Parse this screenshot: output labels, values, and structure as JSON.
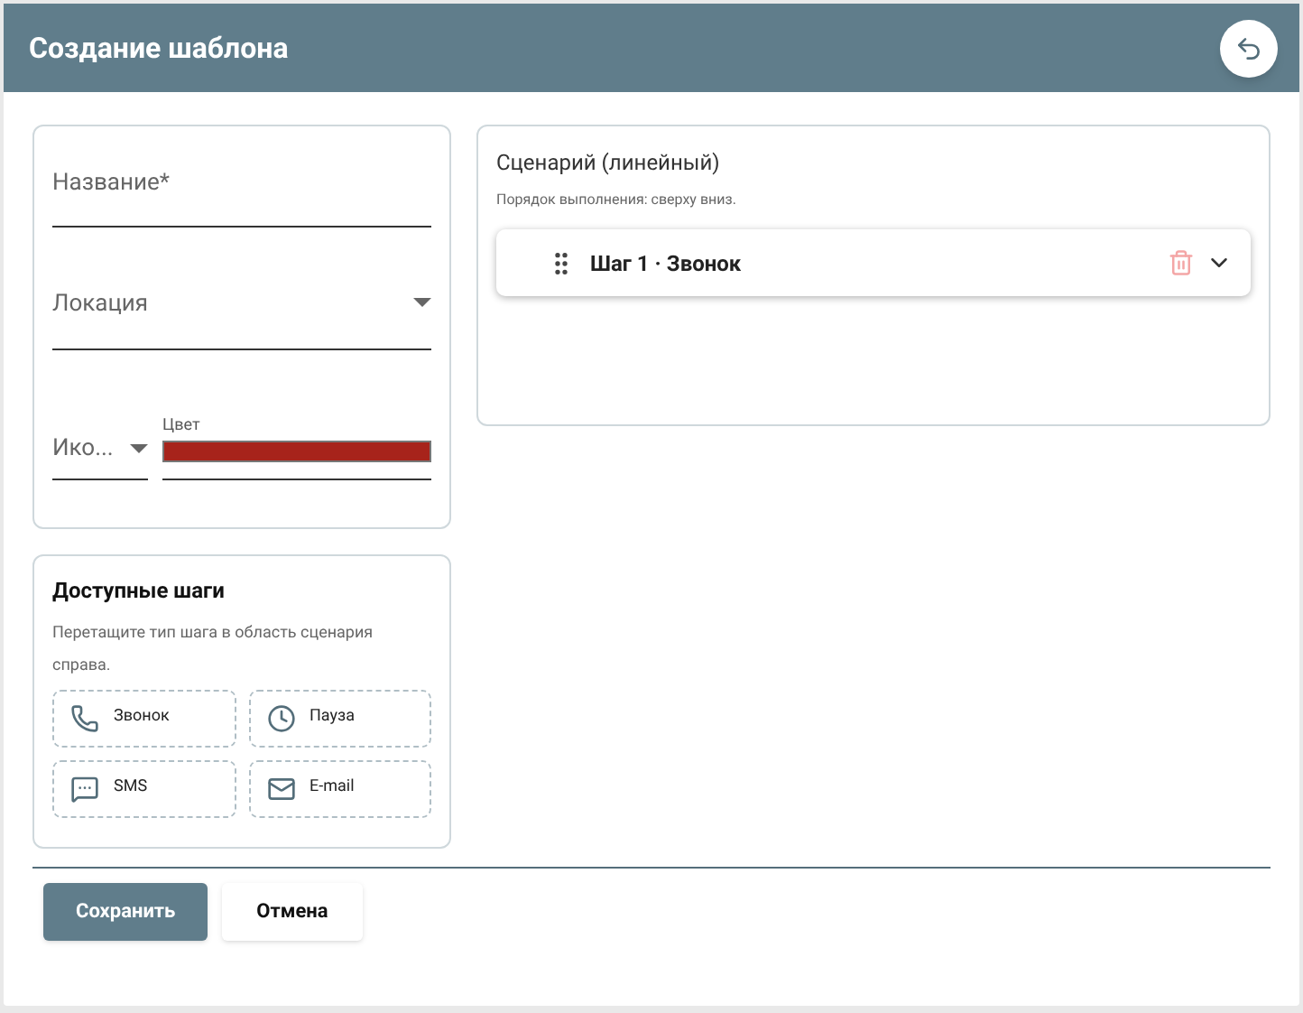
{
  "header": {
    "title": "Создание шаблона"
  },
  "form": {
    "name": {
      "label": "Название*"
    },
    "location": {
      "label": "Локация"
    },
    "icon": {
      "label": "Ико..."
    },
    "color": {
      "label": "Цвет",
      "color": "#a7231b"
    }
  },
  "available_steps": {
    "title": "Доступные шаги",
    "hint": "Перетащите тип шага в область сценария справа.",
    "items": [
      {
        "kind": "call",
        "label": "Звонок"
      },
      {
        "kind": "pause",
        "label": "Пауза"
      },
      {
        "kind": "sms",
        "label": "SMS"
      },
      {
        "kind": "email",
        "label": "E-mail"
      }
    ]
  },
  "scenario": {
    "title": "Сценарий (линейный)",
    "hint": "Порядок выполнения: сверху вниз.",
    "steps": [
      {
        "title": "Шаг 1 · Звонок",
        "expanded": false
      }
    ]
  },
  "buttons": [
    {
      "kind": "primary",
      "label": "Сохранить"
    },
    {
      "kind": "secondary",
      "label": "Отмена"
    }
  ]
}
